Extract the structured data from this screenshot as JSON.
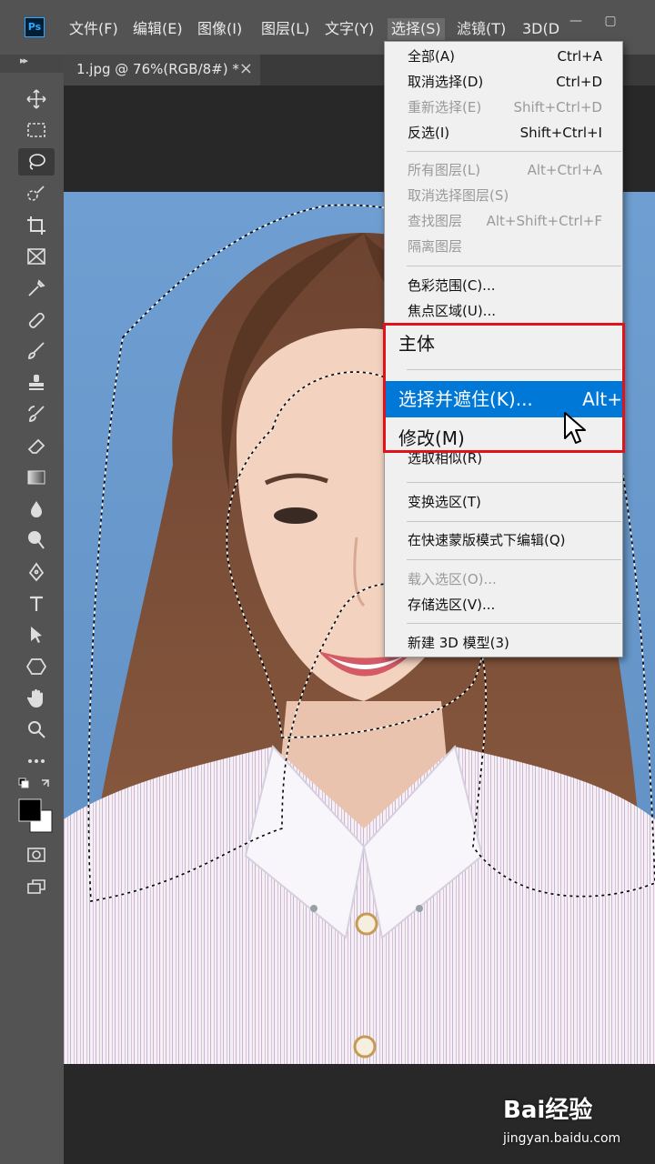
{
  "app": {
    "logo": "Ps"
  },
  "menubar": {
    "items": [
      {
        "label": "文件(F)"
      },
      {
        "label": "编辑(E)"
      },
      {
        "label": "图像(I)"
      },
      {
        "label": "图层(L)"
      },
      {
        "label": "文字(Y)"
      },
      {
        "label": "选择(S)"
      },
      {
        "label": "滤镜(T)"
      },
      {
        "label": "3D(D"
      }
    ],
    "minimize": "—",
    "maximize": "▢"
  },
  "document": {
    "tab_title": "1.jpg @ 76%(RGB/8#) *",
    "close": "×"
  },
  "select_menu": {
    "items": [
      {
        "label": "全部(A)",
        "shortcut": "Ctrl+A"
      },
      {
        "label": "取消选择(D)",
        "shortcut": "Ctrl+D"
      },
      {
        "label": "重新选择(E)",
        "shortcut": "Shift+Ctrl+D"
      },
      {
        "label": "反选(I)",
        "shortcut": "Shift+Ctrl+I"
      },
      {
        "label": "所有图层(L)",
        "shortcut": "Alt+Ctrl+A"
      },
      {
        "label": "取消选择图层(S)",
        "shortcut": ""
      },
      {
        "label": "查找图层",
        "shortcut": "Alt+Shift+Ctrl+F"
      },
      {
        "label": "隔离图层",
        "shortcut": ""
      },
      {
        "label": "色彩范围(C)...",
        "shortcut": ""
      },
      {
        "label": "焦点区域(U)...",
        "shortcut": ""
      },
      {
        "label": "主体",
        "shortcut": ""
      },
      {
        "label": "选择并遮住(K)...",
        "shortcut": "Alt+"
      },
      {
        "label": "修改(M)",
        "shortcut": ""
      },
      {
        "label": "选取相似(R)",
        "shortcut": ""
      },
      {
        "label": "变换选区(T)",
        "shortcut": ""
      },
      {
        "label": "在快速蒙版模式下编辑(Q)",
        "shortcut": ""
      },
      {
        "label": "载入选区(O)...",
        "shortcut": ""
      },
      {
        "label": "存储选区(V)...",
        "shortcut": ""
      },
      {
        "label": "新建 3D 模型(3)",
        "shortcut": ""
      }
    ]
  },
  "toolbar": {
    "tools": [
      "move-icon",
      "marquee-icon",
      "lasso-icon",
      "quick-selection-icon",
      "crop-icon",
      "frame-icon",
      "eyedropper-icon",
      "healing-icon",
      "brush-icon",
      "stamp-icon",
      "history-brush-icon",
      "eraser-icon",
      "gradient-icon",
      "blur-icon",
      "dodge-icon",
      "pen-icon",
      "type-icon",
      "path-select-icon",
      "shape-icon",
      "hand-icon",
      "zoom-icon",
      "more-icon"
    ],
    "foreground_color": "#000000",
    "background_color": "#ffffff"
  },
  "colors": {
    "accent": "#0078d7",
    "highlight_box": "#e0131a",
    "backdrop": "#6a9fd0"
  },
  "watermark": {
    "brand": "Bai经验",
    "url": "jingyan.baidu.com"
  }
}
